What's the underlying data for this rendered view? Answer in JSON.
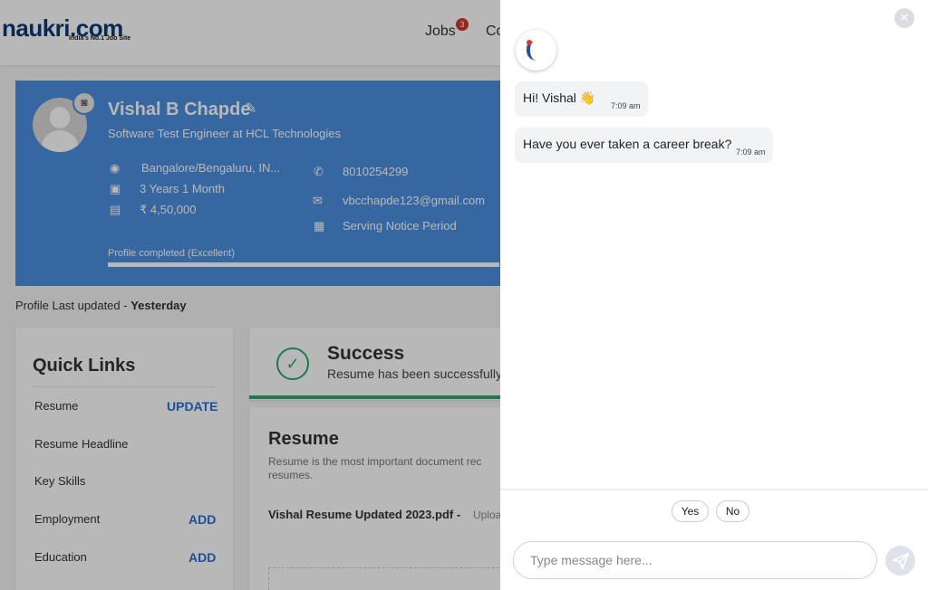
{
  "header": {
    "logo_text": "naukri",
    "logo_suffix": ".com",
    "logo_tagline": "India's No.1 Job Site",
    "nav_jobs": "Jobs",
    "nav_jobs_badge": "3",
    "nav_more": "Co"
  },
  "profile": {
    "name": "Vishal B Chapde",
    "title": "Software Test Engineer at HCL Technologies",
    "location": "Bangalore/Bengaluru, IN...",
    "experience": "3 Years 1 Month",
    "salary": "₹ 4,50,000",
    "phone": "8010254299",
    "email": "vbcchapde123@gmail.com",
    "notice": "Serving Notice Period",
    "completion_label": "Profile completed (Excellent)",
    "completion_percent": 100,
    "last_updated_prefix": "Profile Last updated - ",
    "last_updated_value": "Yesterday"
  },
  "quick_links": {
    "title": "Quick Links",
    "items": [
      {
        "label": "Resume",
        "action": "UPDATE"
      },
      {
        "label": "Resume Headline",
        "action": ""
      },
      {
        "label": "Key Skills",
        "action": ""
      },
      {
        "label": "Employment",
        "action": "ADD"
      },
      {
        "label": "Education",
        "action": "ADD"
      }
    ]
  },
  "success": {
    "title": "Success",
    "text": "Resume has been successfully"
  },
  "resume": {
    "title": "Resume",
    "description": "Resume is the most important document rec resumes.",
    "file_name": "Vishal Resume Updated 2023.pdf -",
    "upload_text": "Uploa"
  },
  "chat": {
    "messages": [
      {
        "text": "Hi! Vishal 👋",
        "time": "7:09 am"
      },
      {
        "text": "Have you ever taken a career break?",
        "time": "7:09 am"
      }
    ],
    "options": [
      "Yes",
      "No"
    ],
    "input_placeholder": "Type message here...",
    "close_icon": "close-icon",
    "send_icon": "send-icon"
  }
}
